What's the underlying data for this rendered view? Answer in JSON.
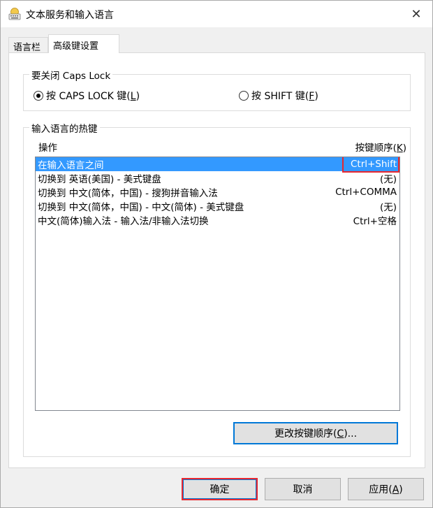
{
  "window": {
    "title": "文本服务和输入语言",
    "close_glyph": "✕"
  },
  "tabs": [
    {
      "label": "语言栏",
      "selected": false
    },
    {
      "label": "高级键设置",
      "selected": true
    }
  ],
  "caps_lock": {
    "legend": "要关闭 Caps Lock",
    "option_caps": {
      "label": "按 CAPS LOCK 键(",
      "mnemonic": "L",
      "suffix": ")",
      "checked": true
    },
    "option_shift": {
      "label": "按 SHIFT 键(",
      "mnemonic": "F",
      "suffix": ")",
      "checked": false
    }
  },
  "hotkeys": {
    "legend": "输入语言的热键",
    "col_action": "操作",
    "col_sequence_label": "按键顺序(",
    "col_sequence_mnemonic": "K",
    "col_sequence_suffix": ")",
    "rows": [
      {
        "action": "在输入语言之间",
        "sequence": "Ctrl+Shift",
        "selected": true
      },
      {
        "action": "切换到 英语(美国) - 美式键盘",
        "sequence": "(无)",
        "selected": false
      },
      {
        "action": "切换到 中文(简体，中国) - 搜狗拼音输入法",
        "sequence": "Ctrl+COMMA",
        "selected": false
      },
      {
        "action": "切换到 中文(简体，中国) - 中文(简体) - 美式键盘",
        "sequence": "(无)",
        "selected": false
      },
      {
        "action": "中文(简体)输入法 - 输入法/非输入法切换",
        "sequence": "Ctrl+空格",
        "selected": false
      }
    ],
    "change_button": {
      "label": "更改按键顺序(",
      "mnemonic": "C",
      "suffix": ")..."
    }
  },
  "footer": {
    "ok_label": "确定",
    "cancel_label": "取消",
    "apply_label": "应用(",
    "apply_mnemonic": "A",
    "apply_suffix": ")"
  },
  "colors": {
    "selection": "#3399ff",
    "highlight_annotation": "#e8272f",
    "focus_border": "#0078d7"
  }
}
